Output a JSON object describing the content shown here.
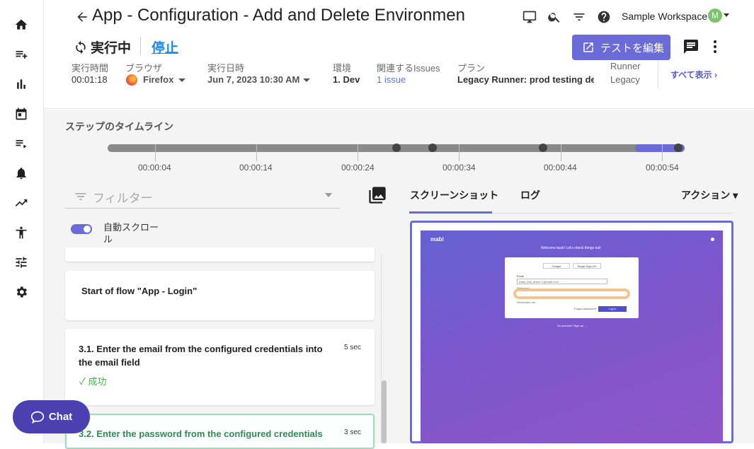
{
  "header": {
    "title": "App - Configuration - Add and Delete Environmen",
    "status": "実行中",
    "stop": "停止",
    "edit_button": "テストを編集",
    "workspace": "Sample Workspace",
    "avatar": "M",
    "show_all": "すべて表示"
  },
  "meta": [
    {
      "label": "実行時間",
      "value": "00:01:18"
    },
    {
      "label": "ブラウザ",
      "value": "Firefox"
    },
    {
      "label": "実行日時",
      "value": "Jun 7, 2023 10:30 AM"
    },
    {
      "label": "環境",
      "value": "1. Dev"
    },
    {
      "label": "関連するIssues",
      "value": "1 issue"
    },
    {
      "label": "プラン",
      "value": "Legacy Runner: prod testing de"
    },
    {
      "label": "Runner",
      "value": "Legacy"
    }
  ],
  "timeline": {
    "title": "ステップのタイムライン",
    "labels": [
      "00:00:04",
      "00:00:14",
      "00:00:24",
      "00:00:34",
      "00:00:44",
      "00:00:54"
    ]
  },
  "steps": {
    "filter_placeholder": "フィルター",
    "autoscroll": "自動スクロール",
    "flow_start": "Start of flow \"App - Login\"",
    "step31": {
      "text": "3.1. Enter the email from the configured credentials into the email field",
      "duration": "5 sec",
      "status": "成功"
    },
    "step32": {
      "text": "3.2. Enter the password from the configured credentials",
      "duration": "3 sec"
    }
  },
  "preview": {
    "tabs": [
      "スクリーンショット",
      "ログ"
    ],
    "actions": "アクション",
    "brand": "mabl",
    "welcome": "Welcome back! Let's check things out!",
    "google": "Google",
    "sso": "Single Sign-On",
    "email_label": "Email",
    "email_value": "trade_test_tester+1@mabl.com",
    "password_label": "Password",
    "remember": "Remember me",
    "forgot": "Forgot password?",
    "login": "Log in",
    "no_account": "No account? Sign up →"
  },
  "chat": {
    "label": "Chat"
  },
  "colors": {
    "accent": "#6a6bd7",
    "link": "#1e88e5",
    "success": "#4caf50",
    "chat": "#4c3fb0"
  }
}
